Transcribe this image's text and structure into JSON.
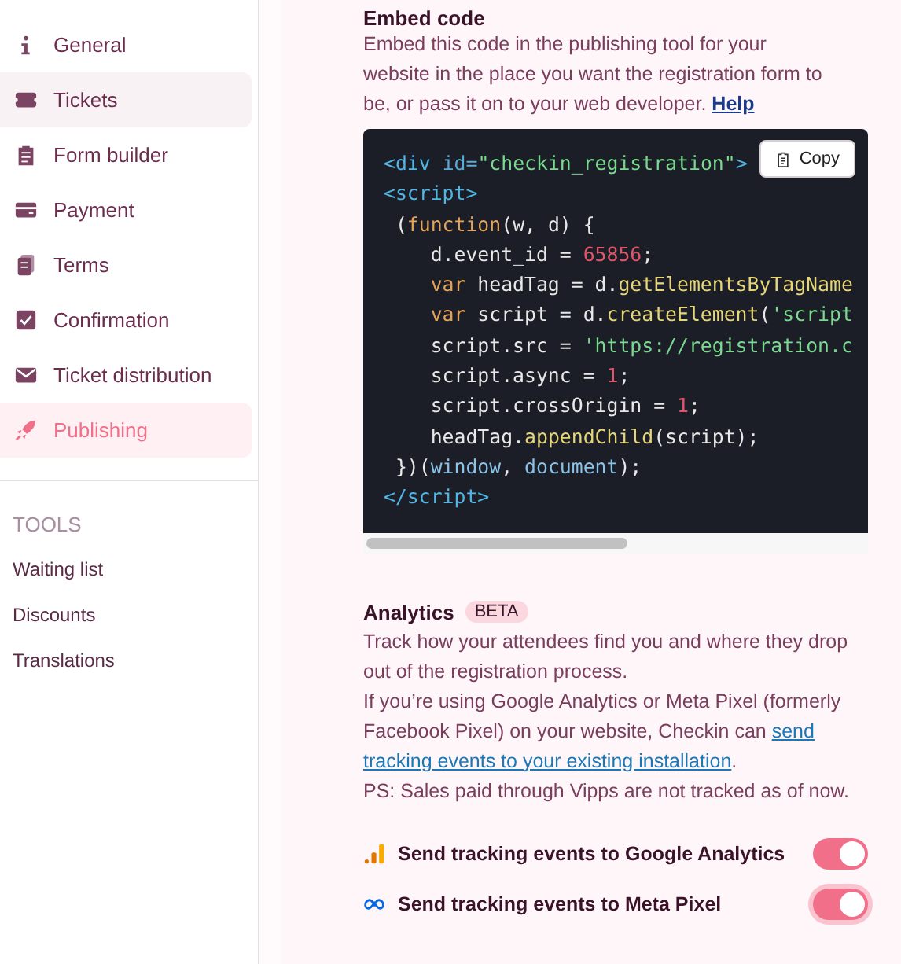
{
  "sidebar": {
    "items": [
      {
        "label": "General",
        "selected": false,
        "hovered": false
      },
      {
        "label": "Tickets",
        "selected": false,
        "hovered": true
      },
      {
        "label": "Form builder",
        "selected": false,
        "hovered": false
      },
      {
        "label": "Payment",
        "selected": false,
        "hovered": false
      },
      {
        "label": "Terms",
        "selected": false,
        "hovered": false
      },
      {
        "label": "Confirmation",
        "selected": false,
        "hovered": false
      },
      {
        "label": "Ticket distribution",
        "selected": false,
        "hovered": false
      },
      {
        "label": "Publishing",
        "selected": true,
        "hovered": false
      }
    ],
    "tools_heading": "TOOLS",
    "tools": [
      {
        "label": "Waiting list"
      },
      {
        "label": "Discounts"
      },
      {
        "label": "Translations"
      }
    ]
  },
  "embed": {
    "title": "Embed code",
    "description": "Embed this code in the publishing tool for your website in the place you want the registration form to be, or pass it on to your web developer.",
    "help_link": "Help",
    "copy_button": "Copy",
    "code_lines": [
      [
        {
          "text": "<div ",
          "kind": "tag"
        },
        {
          "text": "id=",
          "kind": "attr"
        },
        {
          "text": "\"checkin_registration\"",
          "kind": "string"
        },
        {
          "text": ">",
          "kind": "tag"
        }
      ],
      [
        {
          "text": "<script>",
          "kind": "tag"
        }
      ],
      [
        {
          "text": " (",
          "kind": "plain"
        },
        {
          "text": "function",
          "kind": "keyword"
        },
        {
          "text": "(w, d) {",
          "kind": "plain"
        }
      ],
      [
        {
          "text": "    d.event_id = ",
          "kind": "plain"
        },
        {
          "text": "65856",
          "kind": "number"
        },
        {
          "text": ";",
          "kind": "plain"
        }
      ],
      [
        {
          "text": "    var",
          "kind": "keyword"
        },
        {
          "text": " headTag = d.",
          "kind": "plain"
        },
        {
          "text": "getElementsByTagName",
          "kind": "function"
        }
      ],
      [
        {
          "text": "    var",
          "kind": "keyword"
        },
        {
          "text": " script = d.",
          "kind": "plain"
        },
        {
          "text": "createElement",
          "kind": "function"
        },
        {
          "text": "(",
          "kind": "plain"
        },
        {
          "text": "'script",
          "kind": "string"
        }
      ],
      [
        {
          "text": "    script.src = ",
          "kind": "plain"
        },
        {
          "text": "'https://registration.c",
          "kind": "string"
        }
      ],
      [
        {
          "text": "    script.async = ",
          "kind": "plain"
        },
        {
          "text": "1",
          "kind": "number"
        },
        {
          "text": ";",
          "kind": "plain"
        }
      ],
      [
        {
          "text": "    script.crossOrigin = ",
          "kind": "plain"
        },
        {
          "text": "1",
          "kind": "number"
        },
        {
          "text": ";",
          "kind": "plain"
        }
      ],
      [
        {
          "text": "    headTag.",
          "kind": "plain"
        },
        {
          "text": "appendChild",
          "kind": "function"
        },
        {
          "text": "(script);",
          "kind": "plain"
        }
      ],
      [
        {
          "text": " })(",
          "kind": "plain"
        },
        {
          "text": "window",
          "kind": "builtin"
        },
        {
          "text": ", ",
          "kind": "plain"
        },
        {
          "text": "document",
          "kind": "builtin"
        },
        {
          "text": ");",
          "kind": "plain"
        }
      ],
      [
        {
          "text": "</script>",
          "kind": "tag"
        }
      ]
    ]
  },
  "analytics": {
    "title": "Analytics",
    "badge": "BETA",
    "paragraphs": [
      "Track how your attendees find you and where they drop out of the registration process."
    ],
    "link_paragraph": {
      "before": "If you’re using Google Analytics or Meta Pixel (formerly Facebook Pixel) on your website, Checkin can ",
      "link_parts": [
        "send",
        "tracking events to your existing installation"
      ],
      "after": "."
    },
    "note": "PS: Sales paid through Vipps are not tracked as of now.",
    "toggles": [
      {
        "label": "Send tracking events to Google Analytics",
        "on": true,
        "focused": false
      },
      {
        "label": "Send tracking events to Meta Pixel",
        "on": true,
        "focused": true
      }
    ]
  }
}
